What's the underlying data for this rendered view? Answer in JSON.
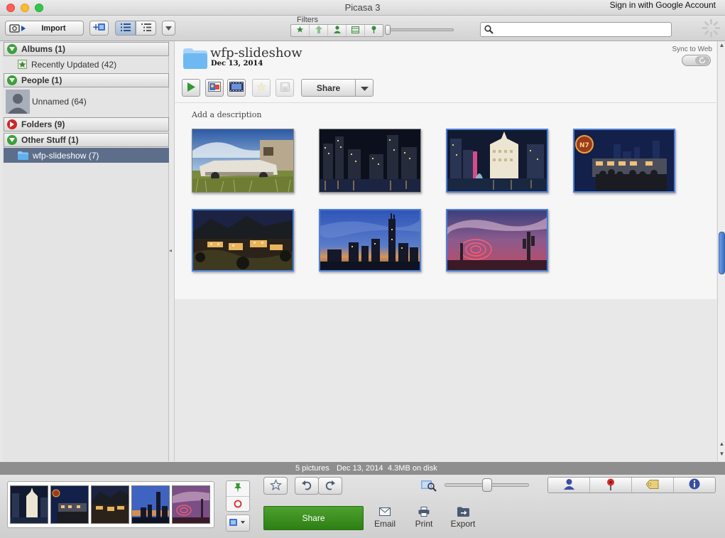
{
  "window": {
    "title": "Picasa 3",
    "sign_in": "Sign in with Google Account"
  },
  "toolbar": {
    "import_label": "Import",
    "filters_label": "Filters",
    "filter_icons": [
      "star-icon",
      "upload-arrow-icon",
      "person-icon",
      "movie-icon",
      "map-pin-icon"
    ],
    "search": {
      "value": "",
      "placeholder": ""
    }
  },
  "sidebar": {
    "sections": [
      {
        "label": "Albums (1)",
        "expanded": true
      },
      {
        "label": "People (1)",
        "expanded": true
      },
      {
        "label": "Folders (9)",
        "expanded": false
      },
      {
        "label": "Other Stuff (1)",
        "expanded": true
      }
    ],
    "items": {
      "recently_updated": "Recently Updated (42)",
      "unnamed": "Unnamed (64)",
      "wfp_slideshow": "wfp-slideshow (7)"
    }
  },
  "album": {
    "title": "wfp-slideshow",
    "date": "Dec 13, 2014",
    "sync_label": "Sync to Web",
    "share_label": "Share",
    "add_description": "Add a description",
    "photos": [
      {
        "name": "vintage-car",
        "selected": false
      },
      {
        "name": "city-night-river",
        "selected": false
      },
      {
        "name": "wrigley-building-night",
        "selected": true
      },
      {
        "name": "nightclub-crowd",
        "selected": true
      },
      {
        "name": "hillside-houses-night",
        "selected": true
      },
      {
        "name": "skyline-dusk",
        "selected": true
      },
      {
        "name": "light-painting-desert",
        "selected": true
      }
    ]
  },
  "status": {
    "count": "5 pictures",
    "date": "Dec 13, 2014",
    "size": "4.3MB on disk"
  },
  "bottom": {
    "share_label": "Share",
    "email_label": "Email",
    "print_label": "Print",
    "export_label": "Export",
    "tray_count": 5
  },
  "colors": {
    "selection": "#5d6e8a",
    "share_green": "#3a8c1e",
    "thumb_selected": "#4d7fd6"
  }
}
